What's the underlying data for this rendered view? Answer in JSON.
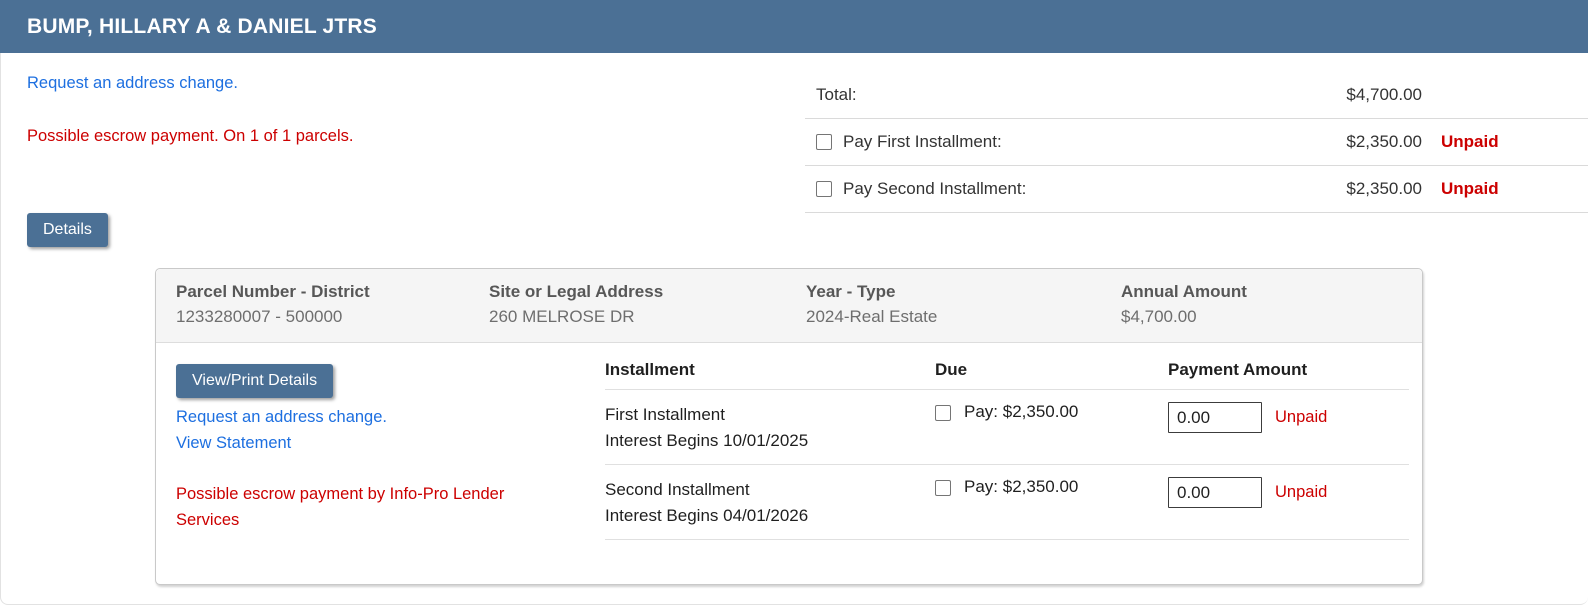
{
  "header": {
    "title": "BUMP, HILLARY A & DANIEL JTRS"
  },
  "notices": {
    "address_change_link": "Request an address change.",
    "escrow_note": "Possible escrow payment. On 1 of 1 parcels."
  },
  "summary": {
    "rows": [
      {
        "label": "Total:",
        "amount": "$4,700.00",
        "status": ""
      },
      {
        "label": "Pay First Installment:",
        "amount": "$2,350.00",
        "status": "Unpaid"
      },
      {
        "label": "Pay Second Installment:",
        "amount": "$2,350.00",
        "status": "Unpaid"
      }
    ]
  },
  "details_button_label": "Details",
  "parcel": {
    "header": [
      {
        "label": "Parcel Number - District",
        "value": "1233280007 - 500000"
      },
      {
        "label": "Site or Legal Address",
        "value": "260 MELROSE DR"
      },
      {
        "label": "Year - Type",
        "value": "2024-Real Estate"
      },
      {
        "label": "Annual Amount",
        "value": "$4,700.00"
      }
    ],
    "actions": {
      "view_print_button_label": "View/Print Details",
      "address_change_link": "Request an address change.",
      "view_statement_link": "View Statement",
      "escrow_note": "Possible escrow payment by Info-Pro Lender Services"
    },
    "table": {
      "columns": [
        "Installment",
        "Due",
        "Payment Amount"
      ],
      "rows": [
        {
          "name": "First Installment",
          "interest": "Interest Begins 10/01/2025",
          "pay": "Pay: $2,350.00",
          "amount_value": "0.00",
          "status": "Unpaid"
        },
        {
          "name": "Second Installment",
          "interest": "Interest Begins 04/01/2026",
          "pay": "Pay: $2,350.00",
          "amount_value": "0.00",
          "status": "Unpaid"
        }
      ]
    }
  },
  "colors": {
    "header_bg": "#4b7095",
    "link_blue": "#1d6fe0",
    "alert_red": "#cc0000"
  }
}
